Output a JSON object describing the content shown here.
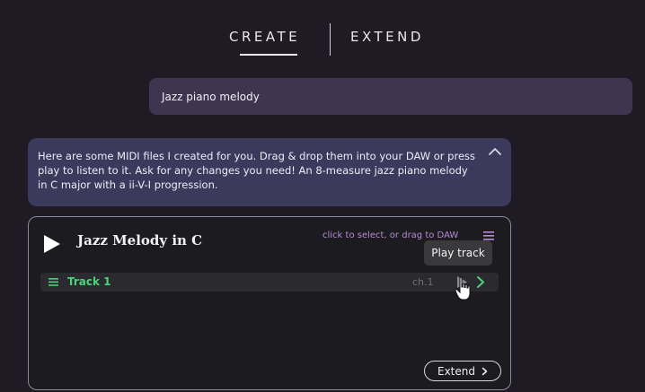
{
  "tabs": [
    {
      "label": "CREATE",
      "active": true
    },
    {
      "label": "EXTEND",
      "active": false
    }
  ],
  "user_message": "Jazz piano melody",
  "assistant_message": "Here are some MIDI files I created for you. Drag & drop them into your DAW or press play to listen to it. Ask for any changes you need! An 8-measure jazz piano melody in C major with a ii-V-I progression.",
  "midi_card": {
    "title": "Jazz Melody in C",
    "drag_hint": "click to select, or drag to DAW",
    "tooltip": "Play track",
    "tracks": [
      {
        "name": "Track 1",
        "channel": "ch.1"
      }
    ],
    "extend_label": "Extend"
  },
  "colors": {
    "background": "#1f1b25",
    "user_bubble": "#3f3550",
    "assistant_bubble": "#3b3a5c",
    "track_green": "#4bd27a",
    "hint_purple": "#b88ad6"
  },
  "icons": [
    "play-icon",
    "chevron-up-icon",
    "menu-icon",
    "chevron-right-icon",
    "hand-cursor-icon"
  ]
}
